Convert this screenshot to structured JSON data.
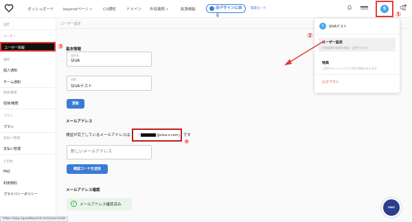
{
  "nav": {
    "dashboard": "ダッシュボード",
    "beyond_page": "beyondページ",
    "cv_note": "CV通知",
    "domain": "ドメイン",
    "external": "外部連携",
    "extension": "拡張機能",
    "new_design": "旧デザインに戻る",
    "dev_mode": "開発モード"
  },
  "user": {
    "avatar_letter": "S"
  },
  "sidebar": {
    "settings": "設定",
    "sec_user": "ユーザー",
    "user_info": "ユーザー情報",
    "sec_notify": "通知",
    "personal_notify": "個人通知",
    "team_notify": "チーム通知",
    "sec_invite": "招待/権限",
    "invite": "招待/権限",
    "sec_plan": "プラン",
    "plan": "プラン",
    "sec_billing": "支払い/管理",
    "billing": "支払い管理",
    "sec_other": "その他",
    "faq": "FAQ",
    "terms": "利用規約",
    "privacy": "プライバシーポリシー"
  },
  "main": {
    "breadcrumb": "ユーザー設定",
    "basic_info": "基本情報",
    "company_label": "会社名",
    "company_value": "SIVA",
    "name_label": "名前",
    "name_value": "SIVAテスト",
    "update_btn": "更新",
    "email_heading": "メールアドレス",
    "verified_prefix": "検証が完了しているメールアドレスは",
    "verified_email_masked": "@siva-s.com」",
    "verified_suffix": "です",
    "new_email_placeholder": "新しいメールアドレス",
    "send_code_btn": "確認コードを送信",
    "email_confirm_heading": "メールアドレス確認",
    "email_confirmed": "メールアドレス確認済み"
  },
  "dropdown": {
    "user_name": "SIVAテスト",
    "user_settings": "ユーザー設定",
    "user_settings_desc": "所属組織の情報を確認・変更できます",
    "perks": "特典",
    "perks_desc": "ご紹介キャッシュバック等の特典があります",
    "logout": "ログアウト"
  },
  "annotations": {
    "one": "①",
    "two": "②",
    "three": "③",
    "four": "④"
  },
  "chat": {
    "label": "FREE"
  },
  "status_url": "https://app.squadbeyond.com/users/edit",
  "colors": {
    "accent": "#3a7bd5",
    "highlight": "#e53935"
  }
}
